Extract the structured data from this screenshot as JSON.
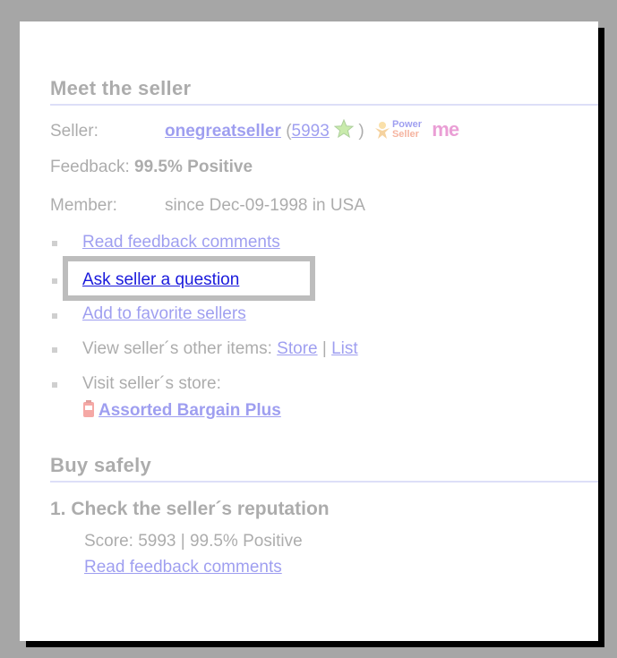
{
  "seller_section": {
    "heading": "Meet the seller",
    "seller_label": "Seller:",
    "seller_name": "onegreatseller",
    "open_paren": "(",
    "feedback_score": "5993",
    "close_paren": ")",
    "feedback_label": "Feedback:",
    "feedback_value": "99.5% Positive",
    "member_label": "Member:",
    "member_value": "since Dec-09-1998 in USA",
    "links": {
      "read_feedback": "Read feedback comments",
      "ask_question": "Ask seller a question",
      "add_favorite": "Add to favorite sellers",
      "other_items_prefix": "View seller´s other items:",
      "store": "Store",
      "separator": "|",
      "list": "List",
      "visit_store_prefix": "Visit seller´s store:",
      "store_name": "Assorted Bargain Plus"
    },
    "badges": {
      "power_seller_line1": "Power",
      "power_seller_line2": "Seller",
      "me_logo": "me"
    }
  },
  "buy_safely_section": {
    "heading": "Buy safely",
    "step1_title": "1. Check the seller´s reputation",
    "score_text": "Score: 5993 | 99.5% Positive",
    "read_feedback": "Read feedback comments"
  },
  "colors": {
    "link": "#1a1adc",
    "heading": "#3b3b3b",
    "rule": "#aeb3ee",
    "highlight_border": "#bdbdbd",
    "backdrop": "#a6a6a6"
  },
  "icons": [
    "green-star-icon",
    "power-seller-icon",
    "me-logo-icon",
    "store-icon",
    "bullet-icon"
  ]
}
